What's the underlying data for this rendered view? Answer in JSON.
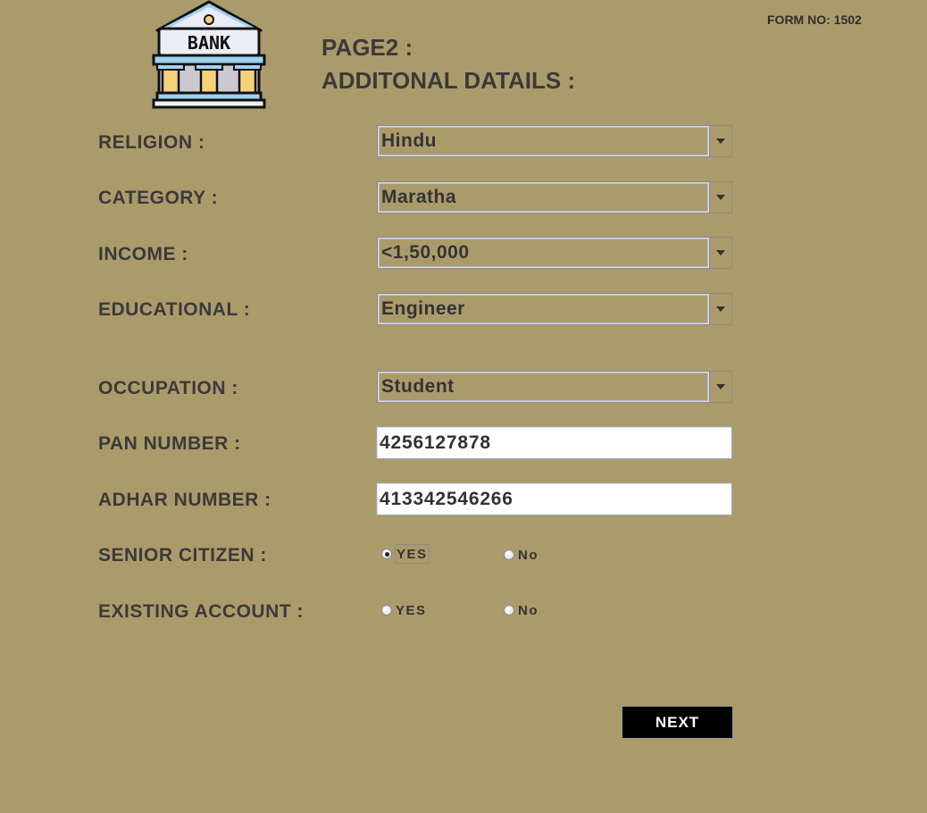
{
  "header": {
    "form_no": "FORM NO: 1502",
    "page_title": "PAGE2 :",
    "page_subtitle": "ADDITONAL DATAILS :",
    "logo_text": "BANK",
    "logo_icon": "bank-building-icon"
  },
  "fields": {
    "religion": {
      "label": "RELIGION :",
      "value": "Hindu"
    },
    "category": {
      "label": "CATEGORY :",
      "value": "Maratha"
    },
    "income": {
      "label": "INCOME :",
      "value": "<1,50,000"
    },
    "educational": {
      "label": "EDUCATIONAL :",
      "value": "Engineer"
    },
    "occupation": {
      "label": "OCCUPATION :",
      "value": "Student"
    },
    "pan": {
      "label": "PAN NUMBER :",
      "value": "4256127878"
    },
    "adhar": {
      "label": "ADHAR NUMBER :",
      "value": "413342546266"
    },
    "senior_citizen": {
      "label": "SENIOR CITIZEN :",
      "yes": "YES",
      "no": "No",
      "selected": "YES"
    },
    "existing_account": {
      "label": "EXISTING ACCOUNT :",
      "yes": "YES",
      "no": "No",
      "selected": ""
    }
  },
  "buttons": {
    "next": "NEXT"
  },
  "colors": {
    "background": "#AB9B6B",
    "text": "#3a3a3a",
    "button_bg": "#000000",
    "button_text": "#FFFFFF"
  }
}
